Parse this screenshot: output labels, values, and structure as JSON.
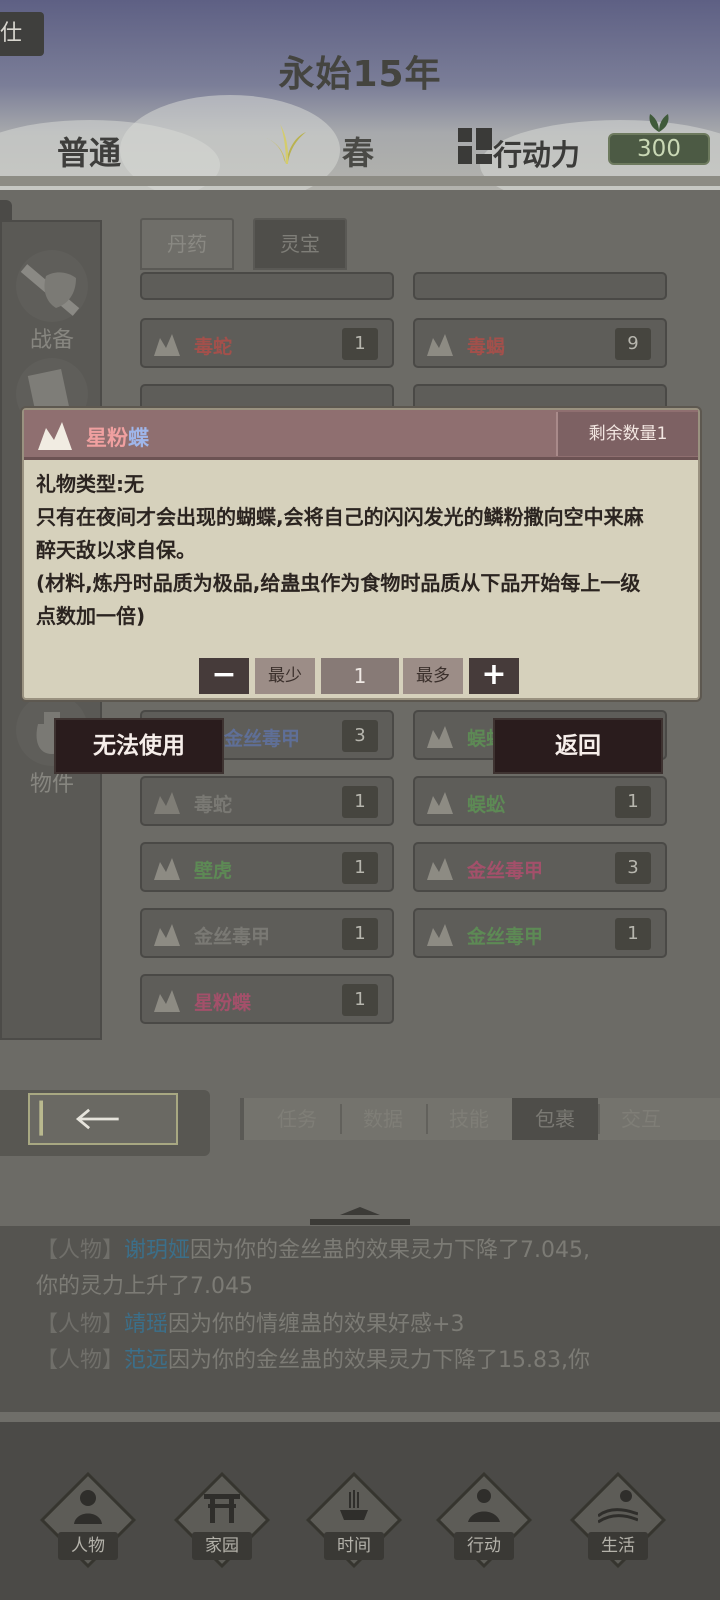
{
  "header": {
    "corner_text": "仕",
    "year": "永始15年",
    "difficulty": "普通",
    "season": "春",
    "action_label": "行动力",
    "action_value": "300"
  },
  "sidebar": {
    "items": [
      {
        "label": "战备"
      },
      {
        "label": "物件"
      }
    ]
  },
  "inventory": {
    "tabs": [
      "丹药",
      "灵宝"
    ],
    "items": [
      {
        "name": "毒蛇",
        "count": "1",
        "color": "red"
      },
      {
        "name": "毒蝎",
        "count": "9",
        "color": "red"
      },
      {
        "name": "金丝毒甲",
        "count": "3",
        "color": "blue"
      },
      {
        "name": "蜈蚣",
        "count": "",
        "color": "green"
      },
      {
        "name": "毒蛇",
        "count": "1",
        "color": "gray"
      },
      {
        "name": "蜈蚣",
        "count": "1",
        "color": "green"
      },
      {
        "name": "壁虎",
        "count": "1",
        "color": "green"
      },
      {
        "name": "金丝毒甲",
        "count": "3",
        "color": "pink"
      },
      {
        "name": "金丝毒甲",
        "count": "1",
        "color": "gray"
      },
      {
        "name": "金丝毒甲",
        "count": "1",
        "color": "green"
      },
      {
        "name": "星粉蝶",
        "count": "1",
        "color": "pinkblue"
      }
    ]
  },
  "bottom_tabs": [
    "任务",
    "数据",
    "技能",
    "包裹",
    "交互"
  ],
  "dialog": {
    "title_part1": "星粉",
    "title_part2": "蝶",
    "remaining": "剩余数量1",
    "line1": "礼物类型:无",
    "line2": "只有在夜间才会出现的蝴蝶,会将自己的闪闪发光的鳞粉撒向空中来麻",
    "line3": "醉天敌以求自保。",
    "line4": "(材料,炼丹时品质为极品,给蛊虫作为食物时品质从下品开始每上一级",
    "line5": "点数加一倍)",
    "minus": "−",
    "min_label": "最少",
    "quantity": "1",
    "max_label": "最多",
    "plus": "+"
  },
  "buttons": {
    "cannot_use": "无法使用",
    "return": "返回"
  },
  "log": {
    "tag": "【人物】",
    "line1_name": "谢玥娅",
    "line1_text": "因为你的金丝蛊的效果灵力下降了7.045,",
    "line2_text": "你的灵力上升了7.045",
    "line3_name": "靖瑶",
    "line3_text": "因为你的情缠蛊的效果好感+3",
    "line4_name": "范远",
    "line4_text": "因为你的金丝蛊的效果灵力下降了15.83,你"
  },
  "nav": [
    "人物",
    "家园",
    "时间",
    "行动",
    "生活"
  ],
  "colors": {
    "dialog_bg": "#d6d1bc",
    "dialog_header": "#8f6f70",
    "button_dark": "#2a1c1d",
    "action_badge": "#4c5a44"
  }
}
